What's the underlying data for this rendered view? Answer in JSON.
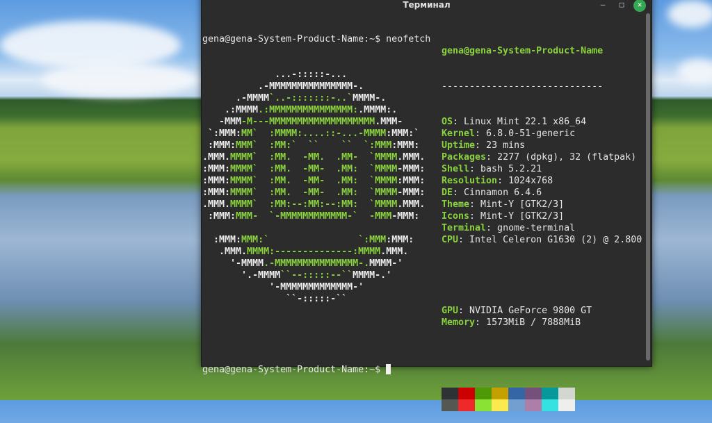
{
  "window": {
    "title": "Терминал"
  },
  "terminal": {
    "command_prompt": "gena@gena-System-Product-Name:~$ neofetch",
    "final_prompt": "gena@gena-System-Product-Name:~$ ",
    "art": [
      [
        [
          "             ...-:::::-...",
          "w"
        ]
      ],
      [
        [
          "          .-MMMMMMMMMMMMMMM-.",
          "w"
        ]
      ],
      [
        [
          "      .-MMMM",
          "w"
        ],
        [
          "`..-:::::::-..`",
          "g"
        ],
        [
          "MMMM-.",
          "w"
        ]
      ],
      [
        [
          "    .:MMMM",
          "w"
        ],
        [
          ".:MMMMMMMMMMMMMMM:",
          "g"
        ],
        [
          ".MMMM:.",
          "w"
        ]
      ],
      [
        [
          "   -MMM",
          "w"
        ],
        [
          "-M---MMMMMMMMMMMMMMMMMMM",
          "g"
        ],
        [
          ".MMM-",
          "w"
        ]
      ],
      [
        [
          " `:MMM:",
          "w"
        ],
        [
          "MM`  :MMMM:....::-...-MMMM",
          "g"
        ],
        [
          ":MMM:`",
          "w"
        ]
      ],
      [
        [
          " :MMM:",
          "w"
        ],
        [
          "MMM`  :MM:`  ``    ``  `:MMM",
          "g"
        ],
        [
          ":MMM:",
          "w"
        ]
      ],
      [
        [
          ".MMM.",
          "w"
        ],
        [
          "MMMM`  :MM.  -MM.  .MM-  `MMMM",
          "g"
        ],
        [
          ".MMM.",
          "w"
        ]
      ],
      [
        [
          ":MMM:",
          "w"
        ],
        [
          "MMMM`  :MM.  -MM-  .MM:  `MMMM",
          "g"
        ],
        [
          "-MMM:",
          "w"
        ]
      ],
      [
        [
          ":MMM:",
          "w"
        ],
        [
          "MMMM`  :MM.  -MM-  .MM:  `MMMM",
          "g"
        ],
        [
          ":MMM:",
          "w"
        ]
      ],
      [
        [
          ":MMM:",
          "w"
        ],
        [
          "MMMM`  :MM.  -MM-  .MM:  `MMMM",
          "g"
        ],
        [
          "-MMM:",
          "w"
        ]
      ],
      [
        [
          ".MMM.",
          "w"
        ],
        [
          "MMMM`  :MM:--:MM:--:MM:  `MMMM",
          "g"
        ],
        [
          ".MMM.",
          "w"
        ]
      ],
      [
        [
          " :MMM:",
          "w"
        ],
        [
          "MMM-  `-MMMMMMMMMMMM-`  -MMM",
          "g"
        ],
        [
          "-MMM:",
          "w"
        ]
      ],
      [],
      [
        [
          "  :MMM:",
          "w"
        ],
        [
          "MMM:`                `:MMM",
          "g"
        ],
        [
          ":MMM:",
          "w"
        ]
      ],
      [
        [
          "   .MMM.",
          "w"
        ],
        [
          "MMMM:--------------:MMMM",
          "g"
        ],
        [
          ".MMM.",
          "w"
        ]
      ],
      [
        [
          "     '-MMMM",
          "w"
        ],
        [
          ".-MMMMMMMMMMMMMMM-.",
          "g"
        ],
        [
          "MMMM-'",
          "w"
        ]
      ],
      [
        [
          "       '.-MMMM",
          "w"
        ],
        [
          "``--:::::--``",
          "g"
        ],
        [
          "MMMM-.'",
          "w"
        ]
      ],
      [
        [
          "            '-MMMMMMMMMMMMM-'",
          "w"
        ]
      ],
      [
        [
          "               ``-:::::-``",
          "w"
        ]
      ]
    ],
    "info": {
      "user": "gena@gena-System-Product-Name",
      "separator": "-----------------------------",
      "rows": [
        {
          "label": "OS",
          "value": ": Linux Mint 22.1 x86_64"
        },
        {
          "label": "Kernel",
          "value": ": 6.8.0-51-generic"
        },
        {
          "label": "Uptime",
          "value": ": 23 mins"
        },
        {
          "label": "Packages",
          "value": ": 2277 (dpkg), 32 (flatpak)"
        },
        {
          "label": "Shell",
          "value": ": bash 5.2.21"
        },
        {
          "label": "Resolution",
          "value": ": 1024x768"
        },
        {
          "label": "DE",
          "value": ": Cinnamon 6.4.6"
        },
        {
          "label": "Theme",
          "value": ": Mint-Y [GTK2/3]"
        },
        {
          "label": "Icons",
          "value": ": Mint-Y [GTK2/3]"
        },
        {
          "label": "Terminal",
          "value": ": gnome-terminal"
        },
        {
          "label": "CPU",
          "value": ": Intel Celeron G1630 (2) @ 2.800"
        }
      ],
      "rows2": [
        {
          "label": "GPU",
          "value": ": NVIDIA GeForce 9800 GT"
        },
        {
          "label": "Memory",
          "value": ": 1573MiB / 7888MiB"
        }
      ],
      "palette": [
        "#2e3234",
        "#cc0000",
        "#4e9a06",
        "#c4a000",
        "#3465a4",
        "#75507b",
        "#06989a",
        "#d3d7cf",
        "#555753",
        "#ef2929",
        "#8ae234",
        "#fce94f",
        "#729fcf",
        "#ad7fa8",
        "#34e2e2",
        "#eeeeec"
      ]
    }
  },
  "colors": {
    "green": "#8ad33f",
    "close": "#35a854",
    "bg": "#2c2c2c"
  }
}
